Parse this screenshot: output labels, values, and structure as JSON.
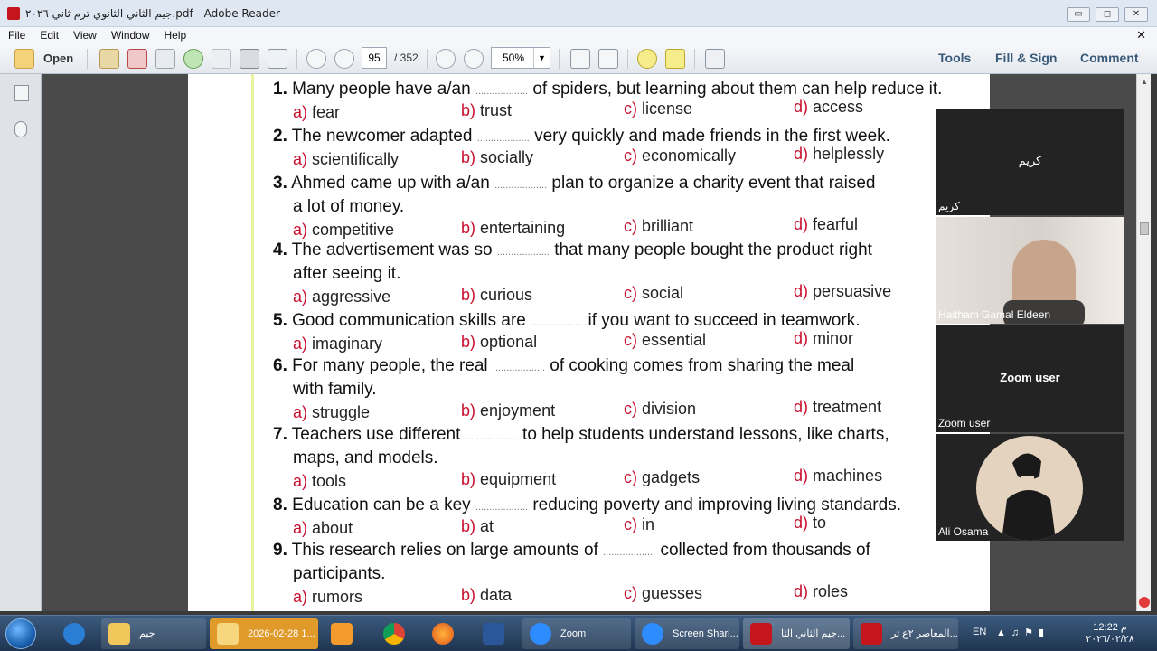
{
  "window": {
    "title": "جيم الثاني الثانوي ترم ثاني ٢٠٢٦.pdf - Adobe Reader",
    "btn_min": "▭",
    "btn_max": "◻",
    "btn_close": "✕"
  },
  "menu": {
    "items": [
      "File",
      "Edit",
      "View",
      "Window",
      "Help"
    ],
    "close": "✕"
  },
  "toolbar": {
    "open": "Open",
    "page_current": "95",
    "page_total": "/  352",
    "zoom": "50%",
    "zoom_dd": "▼",
    "tools": "Tools",
    "fill_sign": "Fill & Sign",
    "comment": "Comment"
  },
  "questions": [
    {
      "num": "1.",
      "pre": "Many people have a/an",
      "post": "of spiders, but learning about them can help reduce it.",
      "line2": "",
      "opts": [
        "fear",
        "trust",
        "license",
        "access"
      ]
    },
    {
      "num": "2.",
      "pre": "The newcomer adapted",
      "post": "very quickly and made friends in the first week.",
      "line2": "",
      "opts": [
        "scientifically",
        "socially",
        "economically",
        "helplessly"
      ]
    },
    {
      "num": "3.",
      "pre": "Ahmed came up with a/an",
      "post": "plan to organize a charity event that raised",
      "line2": "a lot of money.",
      "opts": [
        "competitive",
        "entertaining",
        "brilliant",
        "fearful"
      ]
    },
    {
      "num": "4.",
      "pre": "The advertisement was so",
      "post": "that many people bought the product right",
      "line2": "after seeing it.",
      "opts": [
        "aggressive",
        "curious",
        "social",
        "persuasive"
      ]
    },
    {
      "num": "5.",
      "pre": "Good communication skills are",
      "post": "if you want to succeed in teamwork.",
      "line2": "",
      "opts": [
        "imaginary",
        "optional",
        "essential",
        "minor"
      ]
    },
    {
      "num": "6.",
      "pre": "For many people, the real",
      "post": "of cooking comes from sharing the meal",
      "line2": "with family.",
      "opts": [
        "struggle",
        "enjoyment",
        "division",
        "treatment"
      ]
    },
    {
      "num": "7.",
      "pre": "Teachers use different",
      "post": "to help students understand lessons, like charts,",
      "line2": "maps, and models.",
      "opts": [
        "tools",
        "equipment",
        "gadgets",
        "machines"
      ]
    },
    {
      "num": "8.",
      "pre": "Education can be a key",
      "post": "reducing poverty and improving living standards.",
      "line2": "",
      "opts": [
        "about",
        "at",
        "in",
        "to"
      ]
    },
    {
      "num": "9.",
      "pre": "This research relies on large amounts of",
      "post": "collected from thousands of",
      "line2": "participants.",
      "opts": [
        "rumors",
        "data",
        "guesses",
        "roles"
      ]
    }
  ],
  "option_letters": [
    "a)",
    "b)",
    "c)",
    "d)"
  ],
  "blank": "...................",
  "zoom_panel": {
    "p1_center": "كريم",
    "p1_name": "كريم",
    "p2_name": "Haitham Gamal Eldeen",
    "p3_center": "Zoom user",
    "p3_name": "Zoom user",
    "p4_name": "Ali Osama"
  },
  "taskbar": {
    "items": [
      "جيم",
      "2026-02-28 1...",
      "Zoom",
      "Screen Shari...",
      "جيم الثاني الثا...",
      "المعاصر ٢ع تر..."
    ],
    "lang": "EN",
    "time": "12:22 م",
    "date": "٢٠٢٦/٠٢/٢٨"
  },
  "colors": {
    "option_letter": "#c8102e",
    "accent_toolbar_text": "#3a5a7a",
    "margin_rule": "#e8f2a0"
  }
}
